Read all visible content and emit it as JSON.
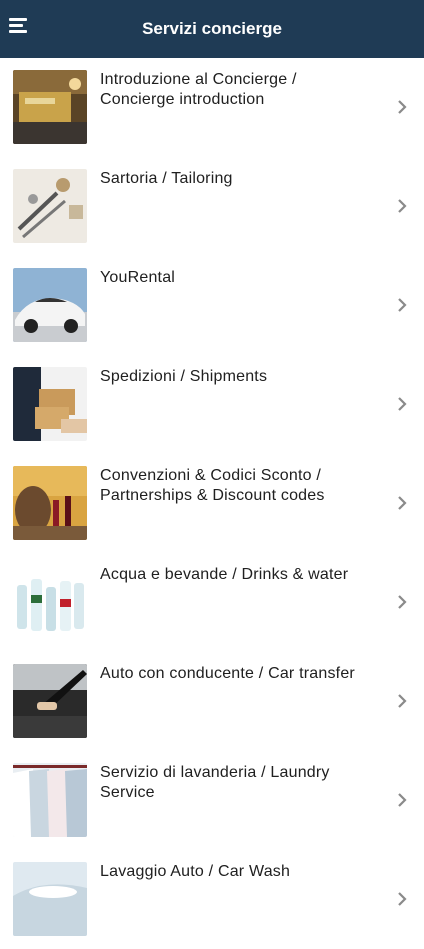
{
  "header": {
    "title": "Servizi concierge"
  },
  "items": [
    {
      "label": "Introduzione al Concierge / Concierge introduction",
      "thumb": "concierge-desk"
    },
    {
      "label": "Sartoria / Tailoring",
      "thumb": "tailoring-tools"
    },
    {
      "label": "YouRental",
      "thumb": "sports-car"
    },
    {
      "label": "Spedizioni / Shipments",
      "thumb": "parcel-delivery"
    },
    {
      "label": "Convenzioni & Codici Sconto / Partnerships & Discount codes",
      "thumb": "wine-barrel"
    },
    {
      "label": "Acqua e bevande / Drinks & water",
      "thumb": "water-bottles"
    },
    {
      "label": "Auto con conducente / Car transfer",
      "thumb": "car-door"
    },
    {
      "label": "Servizio di lavanderia / Laundry Service",
      "thumb": "shirts-rack"
    },
    {
      "label": "Lavaggio Auto / Car Wash",
      "thumb": "car-wash"
    }
  ]
}
